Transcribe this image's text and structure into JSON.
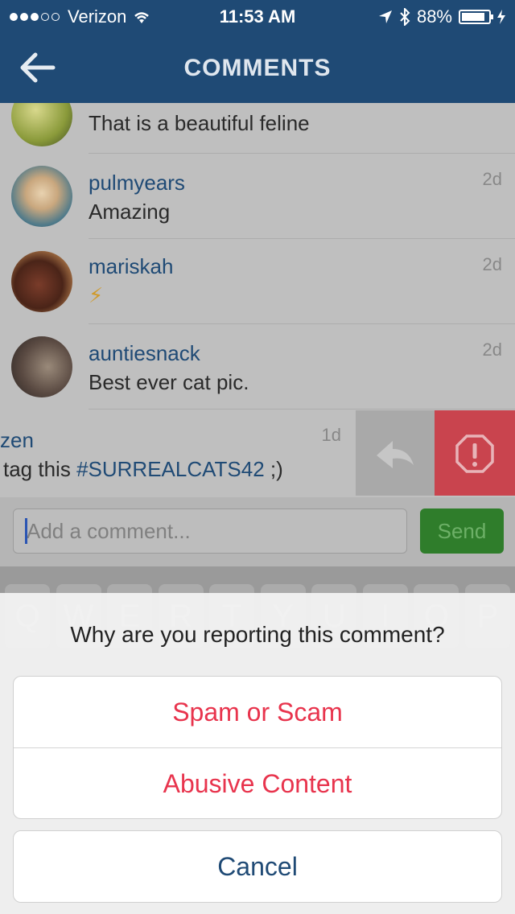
{
  "status_bar": {
    "carrier": "Verizon",
    "time": "11:53 AM",
    "battery": "88%",
    "battery_level": 0.88
  },
  "header": {
    "title": "COMMENTS"
  },
  "comments": [
    {
      "username": "",
      "text": "That is a beautiful feline",
      "age": ""
    },
    {
      "username": "pulmyears",
      "text": "Amazing",
      "age": "2d"
    },
    {
      "username": "mariskah",
      "text": "⚡",
      "age": "2d"
    },
    {
      "username": "auntiesnack",
      "text": "Best ever cat pic.",
      "age": "2d"
    }
  ],
  "swiped_comment": {
    "username_fragment": "zen",
    "text_before": "tag this ",
    "hashtag": "#SURREALCATS42",
    "text_after": " ;)",
    "age": "1d"
  },
  "composer": {
    "placeholder": "Add a comment...",
    "send_label": "Send"
  },
  "keyboard": {
    "row1": [
      "Q",
      "W",
      "E",
      "R",
      "T",
      "Y",
      "U",
      "I",
      "O",
      "P"
    ]
  },
  "report_sheet": {
    "question": "Why are you reporting this comment?",
    "options": [
      "Spam or Scam",
      "Abusive Content"
    ],
    "cancel": "Cancel"
  },
  "colors": {
    "nav": "#1f4a75",
    "username": "#1f4a75",
    "destructive": "#e8344d",
    "report_button": "#c9444e",
    "send_button": "#2f7d2b"
  }
}
